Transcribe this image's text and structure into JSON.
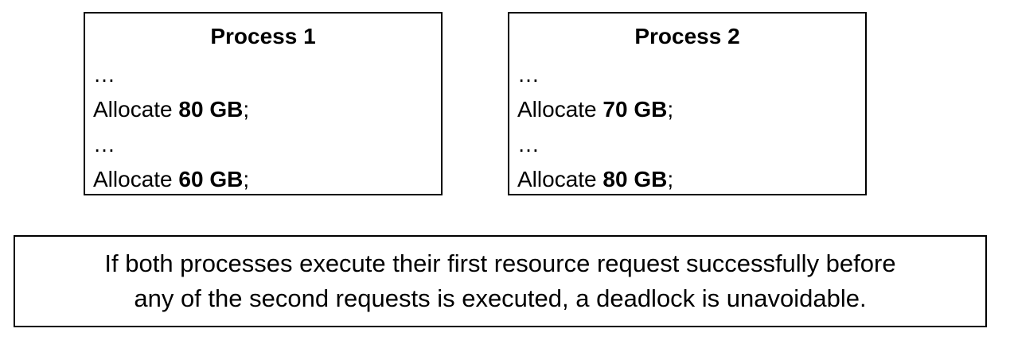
{
  "processes": [
    {
      "title": "Process 1",
      "lines": [
        {
          "text": "…"
        },
        {
          "prefix": "Allocate ",
          "amount": "80 GB",
          "suffix": ";"
        },
        {
          "text": "…"
        },
        {
          "prefix": "Allocate ",
          "amount": "60 GB",
          "suffix": ";"
        }
      ]
    },
    {
      "title": "Process 2",
      "lines": [
        {
          "text": "…"
        },
        {
          "prefix": "Allocate ",
          "amount": "70 GB",
          "suffix": ";"
        },
        {
          "text": "…"
        },
        {
          "prefix": "Allocate ",
          "amount": "80 GB",
          "suffix": ";"
        }
      ]
    }
  ],
  "note": {
    "line1": "If both processes execute their first resource request successfully before",
    "line2": "any of the second requests is executed, a deadlock is unavoidable."
  }
}
